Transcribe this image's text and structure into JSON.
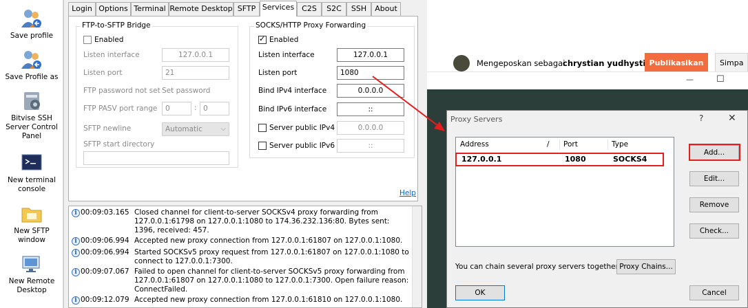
{
  "sidebar": {
    "items": [
      {
        "label": "Save profile"
      },
      {
        "label": "Save Profile as"
      },
      {
        "label": "Bitvise SSH Server Control Panel"
      },
      {
        "label": "New terminal console"
      },
      {
        "label": "New SFTP window"
      },
      {
        "label": "New Remote Desktop"
      }
    ]
  },
  "tabs": [
    "Login",
    "Options",
    "Terminal",
    "Remote Desktop",
    "SFTP",
    "Services",
    "C2S",
    "S2C",
    "SSH",
    "About"
  ],
  "active_tab": "Services",
  "ftp_bridge": {
    "title": "FTP-to-SFTP Bridge",
    "enabled_label": "Enabled",
    "enabled": false,
    "listen_interface_label": "Listen interface",
    "listen_interface": "127.0.0.1",
    "listen_port_label": "Listen port",
    "listen_port": "21",
    "ftp_password_label": "FTP password not set",
    "set_password_label": "Set password",
    "pasv_label": "FTP PASV port range",
    "pasv_from": "0",
    "pasv_sep": ":",
    "pasv_to": "0",
    "newline_label": "SFTP newline",
    "newline_value": "Automatic",
    "start_dir_label": "SFTP start directory",
    "start_dir": ""
  },
  "socks_proxy": {
    "title": "SOCKS/HTTP Proxy Forwarding",
    "enabled_label": "Enabled",
    "enabled": true,
    "listen_interface_label": "Listen interface",
    "listen_interface": "127.0.0.1",
    "listen_port_label": "Listen port",
    "listen_port": "1080",
    "bind_ipv4_label": "Bind IPv4 interface",
    "bind_ipv4": "0.0.0.0",
    "bind_ipv6_label": "Bind IPv6 interface",
    "bind_ipv6": "::",
    "public_ipv4_label": "Server public IPv4",
    "public_ipv4": "0.0.0.0",
    "public_ipv6_label": "Server public IPv6",
    "public_ipv6": "::"
  },
  "help_link": "Help",
  "log": [
    {
      "time": "00:09:03.165",
      "message": "Closed channel for client-to-server SOCKSv4 proxy forwarding from 127.0.0.1:61798 on 127.0.0.1:1080 to 174.36.232.136:80. Bytes sent: 1396, received: 457."
    },
    {
      "time": "00:09:06.994",
      "message": "Accepted new proxy connection from 127.0.0.1:61807 on 127.0.0.1:1080."
    },
    {
      "time": "00:09:06.994",
      "message": "Started SOCKSv5 proxy request from 127.0.0.1:61807 on 127.0.0.1:1080 to connect to 127.0.0.1:7300."
    },
    {
      "time": "00:09:07.067",
      "message": "Failed to open channel for client-to-server SOCKSv5 proxy forwarding from 127.0.0.1:61807 on 127.0.0.1:1080 to 127.0.0.1:7300. Open failure reason: ConnectFailed."
    },
    {
      "time": "00:09:12.079",
      "message": "Accepted new proxy connection from 127.0.0.1:61810 on 127.0.0.1:1080."
    }
  ],
  "browser": {
    "posting_as_prefix": "Mengeposkan sebagai",
    "posting_as_user": "chrystian yudhystira",
    "publish_label": "Publikasikan",
    "save_label": "Simpa",
    "minimize_glyph": "—",
    "maximize_glyph": "☐"
  },
  "proxy_dialog": {
    "title": "Proxy Servers",
    "help_glyph": "?",
    "close_glyph": "✕",
    "columns": [
      "Address",
      "/",
      "Port",
      "Type"
    ],
    "rows": [
      {
        "address": "127.0.0.1",
        "port": "1080",
        "type": "SOCKS4"
      }
    ],
    "add_label": "Add...",
    "edit_label": "Edit...",
    "remove_label": "Remove",
    "check_label": "Check...",
    "chain_text": "You can chain several proxy servers together:",
    "chains_label": "Proxy Chains...",
    "ok_label": "OK",
    "cancel_label": "Cancel"
  },
  "colors": {
    "annotation_red": "#e41e1e",
    "publish_orange": "#f36c3d",
    "link_blue": "#0066cc"
  }
}
